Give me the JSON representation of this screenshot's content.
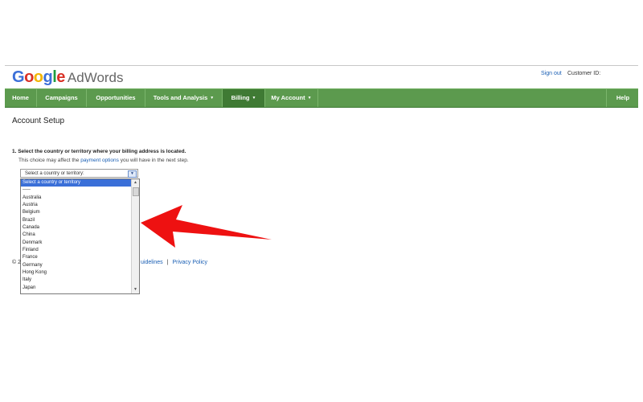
{
  "header": {
    "logo_google": "Google",
    "logo_product": "AdWords",
    "sign_out": "Sign out",
    "customer_id_label": "Customer ID:"
  },
  "nav": {
    "home": "Home",
    "campaigns": "Campaigns",
    "opportunities": "Opportunities",
    "tools": "Tools and Analysis",
    "billing": "Billing",
    "my_account": "My Account",
    "help": "Help"
  },
  "page": {
    "title": "Account Setup",
    "step_label": "1. Select the country or territory where your billing address is located.",
    "note_prefix": "This choice may affect the",
    "note_link": "payment options",
    "note_suffix": "you will have in the next step."
  },
  "country_select": {
    "value": "Select a country or territory:",
    "options": [
      "Select a country or territory",
      "-----",
      "Australia",
      "Austria",
      "Belgium",
      "Brazil",
      "Canada",
      "China",
      "Denmark",
      "Finland",
      "France",
      "Germany",
      "Hong Kong",
      "Italy",
      "Japan"
    ]
  },
  "footer": {
    "copyright": "© 2",
    "guidelines": "uidelines",
    "privacy": "Privacy Policy"
  },
  "colors": {
    "nav_bg": "#5c9a4e",
    "nav_active": "#3f7a34",
    "link": "#1a5fb4",
    "arrow": "#ee1111"
  }
}
